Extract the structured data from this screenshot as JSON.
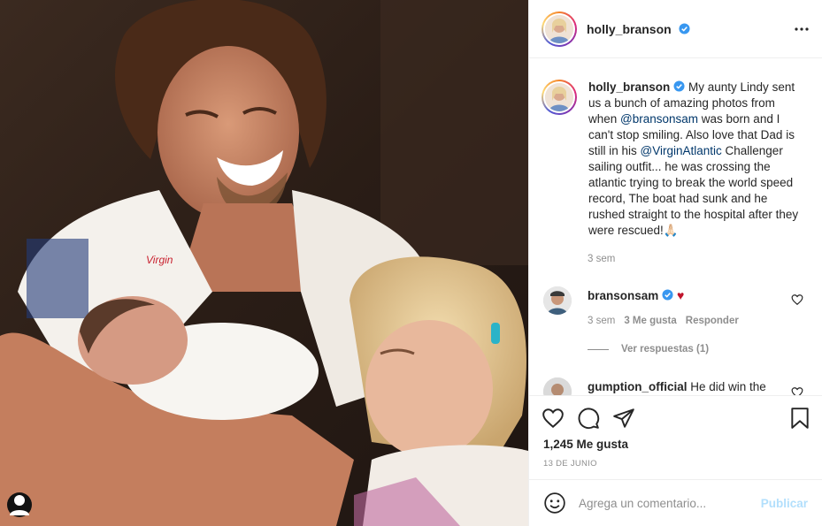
{
  "post": {
    "photo_alt": "",
    "username": "holly_branson",
    "verified": true,
    "menu_icon": "more-options-icon",
    "tag_icon": "user-tag-icon"
  },
  "caption": {
    "username": "holly_branson",
    "part1": " My aunty Lindy sent us a bunch of amazing photos from when ",
    "mention1": "@bransonsam",
    "part2": " was born and I can't stop smiling. Also love that Dad is still in his ",
    "mention2": "@VirginAtlantic",
    "part3": " Challenger sailing outfit... he was crossing the atlantic trying to break the world speed record, The boat had sunk and he rushed straight to the hospital after they were rescued!",
    "emojis": "🙏🏻",
    "time": "3 sem"
  },
  "comments": [
    {
      "username": "bransonsam",
      "text": "♥",
      "time": "3 sem",
      "likes": "3 Me gusta",
      "reply_label": "Responder",
      "view_replies": "Ver respuestas (1)"
    },
    {
      "username": "gumption_official",
      "text": " He did win the"
    }
  ],
  "actions": {
    "likes": "1,245 Me gusta",
    "date": "13 DE JUNIO"
  },
  "composer": {
    "placeholder": "Agrega un comentario...",
    "publish_label": "Publicar"
  },
  "colors": {
    "accent": "#0095f6",
    "publish_disabled": "#b2dffc",
    "verified": "#3897f0",
    "link": "#00376b"
  }
}
